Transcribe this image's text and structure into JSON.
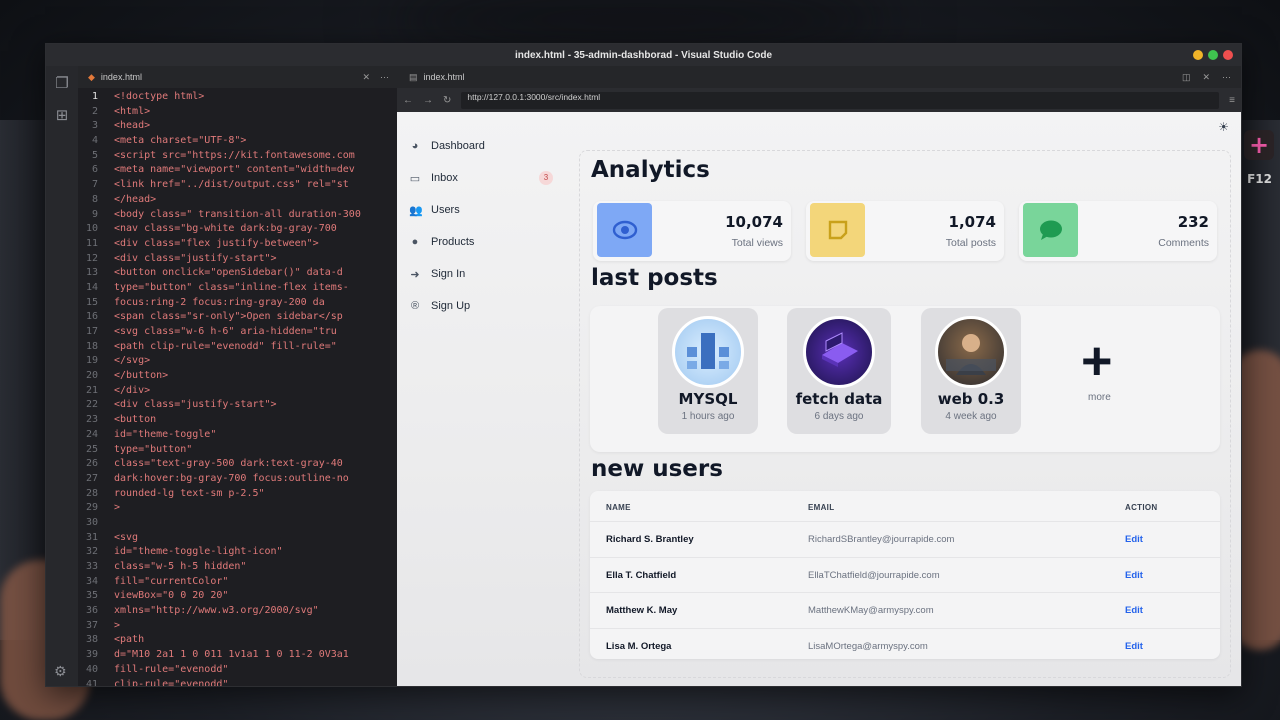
{
  "window": {
    "title": "index.html - 35-admin-dashborad - Visual Studio Code"
  },
  "editor": {
    "tab_label": "index.html",
    "code_lines": [
      {
        "n": "1",
        "text": "<!doctype html>"
      },
      {
        "n": "2",
        "text": "<html>"
      },
      {
        "n": "3",
        "text": "<head>"
      },
      {
        "n": "4",
        "text": "  <meta charset=\"UTF-8\">"
      },
      {
        "n": "5",
        "text": "  <script src=\"https://kit.fontawesome.com"
      },
      {
        "n": "6",
        "text": "  <meta name=\"viewport\" content=\"width=dev"
      },
      {
        "n": "7",
        "text": "  <link href=\"../dist/output.css\" rel=\"st"
      },
      {
        "n": "8",
        "text": "</head>"
      },
      {
        "n": "9",
        "text": "<body class=\" transition-all duration-300"
      },
      {
        "n": "10",
        "text": "<nav class=\"bg-white dark:bg-gray-700"
      },
      {
        "n": "11",
        "text": "  <div class=\"flex justify-between\">"
      },
      {
        "n": "12",
        "text": "<div class=\"justify-start\">"
      },
      {
        "n": "13",
        "text": "  <button  onclick=\"openSidebar()\" data-d"
      },
      {
        "n": "14",
        "text": "  type=\"button\" class=\"inline-flex items-"
      },
      {
        "n": "15",
        "text": "  focus:ring-2 focus:ring-gray-200 da"
      },
      {
        "n": "16",
        "text": "    <span class=\"sr-only\">Open sidebar</sp"
      },
      {
        "n": "17",
        "text": "    <svg class=\"w-6 h-6\" aria-hidden=\"tru"
      },
      {
        "n": "18",
        "text": "    <path clip-rule=\"evenodd\" fill-rule=\""
      },
      {
        "n": "19",
        "text": "    </svg>"
      },
      {
        "n": "20",
        "text": "  </button>"
      },
      {
        "n": "21",
        "text": "</div>"
      },
      {
        "n": "22",
        "text": "<div class=\"justify-start\">"
      },
      {
        "n": "23",
        "text": "  <button"
      },
      {
        "n": "24",
        "text": "id=\"theme-toggle\""
      },
      {
        "n": "25",
        "text": "type=\"button\""
      },
      {
        "n": "26",
        "text": "class=\"text-gray-500 dark:text-gray-40"
      },
      {
        "n": "27",
        "text": " dark:hover:bg-gray-700 focus:outline-no"
      },
      {
        "n": "28",
        "text": "rounded-lg text-sm p-2.5\""
      },
      {
        "n": "29",
        "text": ">"
      },
      {
        "n": "30",
        "text": ""
      },
      {
        "n": "31",
        "text": "<svg"
      },
      {
        "n": "32",
        "text": " id=\"theme-toggle-light-icon\""
      },
      {
        "n": "33",
        "text": " class=\"w-5 h-5 hidden\""
      },
      {
        "n": "34",
        "text": " fill=\"currentColor\""
      },
      {
        "n": "35",
        "text": " viewBox=\"0 0 20 20\""
      },
      {
        "n": "36",
        "text": " xmlns=\"http://www.w3.org/2000/svg\""
      },
      {
        "n": "37",
        "text": " >"
      },
      {
        "n": "38",
        "text": "  <path"
      },
      {
        "n": "39",
        "text": "    d=\"M10 2a1 1 0 011 1v1a1 1 0 11-2 0V3a1"
      },
      {
        "n": "40",
        "text": "    fill-rule=\"evenodd\""
      },
      {
        "n": "41",
        "text": "    clip-rule=\"evenodd\""
      }
    ]
  },
  "preview": {
    "tab_label": "index.html",
    "url": "http://127.0.0.1:3000/src/index.html"
  },
  "sidebar": {
    "items": [
      {
        "label": "Dashboard",
        "icon": "dashboard-icon",
        "glyph": "◕"
      },
      {
        "label": "Inbox",
        "icon": "inbox-icon",
        "glyph": "▭",
        "badge": "3"
      },
      {
        "label": "Users",
        "icon": "users-icon",
        "glyph": "👥"
      },
      {
        "label": "Products",
        "icon": "products-icon",
        "glyph": "●"
      },
      {
        "label": "Sign In",
        "icon": "sign-in-icon",
        "glyph": "➜"
      },
      {
        "label": "Sign Up",
        "icon": "sign-up-icon",
        "glyph": "®"
      }
    ]
  },
  "analytics": {
    "title": "Analytics",
    "cards": [
      {
        "value": "10,074",
        "label": "Total views",
        "icon": "eye-icon",
        "color": "#7ea8f5"
      },
      {
        "value": "1,074",
        "label": "Total posts",
        "icon": "note-icon",
        "color": "#f3d67a"
      },
      {
        "value": "232",
        "label": "Comments",
        "icon": "comment-icon",
        "color": "#79d59a"
      }
    ]
  },
  "posts": {
    "title": "last posts",
    "items": [
      {
        "title": "MYSQL",
        "time": "1 hours ago"
      },
      {
        "title": "fetch data",
        "time": "6 days ago"
      },
      {
        "title": "web 0.3",
        "time": "4 week ago"
      }
    ],
    "more_label": "more"
  },
  "users": {
    "title": "new users",
    "columns": [
      "NAME",
      "EMAIL",
      "ACTION"
    ],
    "rows": [
      {
        "name": "Richard S. Brantley",
        "email": "RichardSBrantley@jourrapide.com",
        "action": "Edit"
      },
      {
        "name": "Ella T. Chatfield",
        "email": "EllaTChatfield@jourrapide.com",
        "action": "Edit"
      },
      {
        "name": "Matthew K. May",
        "email": "MatthewKMay@armyspy.com",
        "action": "Edit"
      },
      {
        "name": "Lisa M. Ortega",
        "email": "LisaMOrtega@armyspy.com",
        "action": "Edit"
      }
    ]
  }
}
